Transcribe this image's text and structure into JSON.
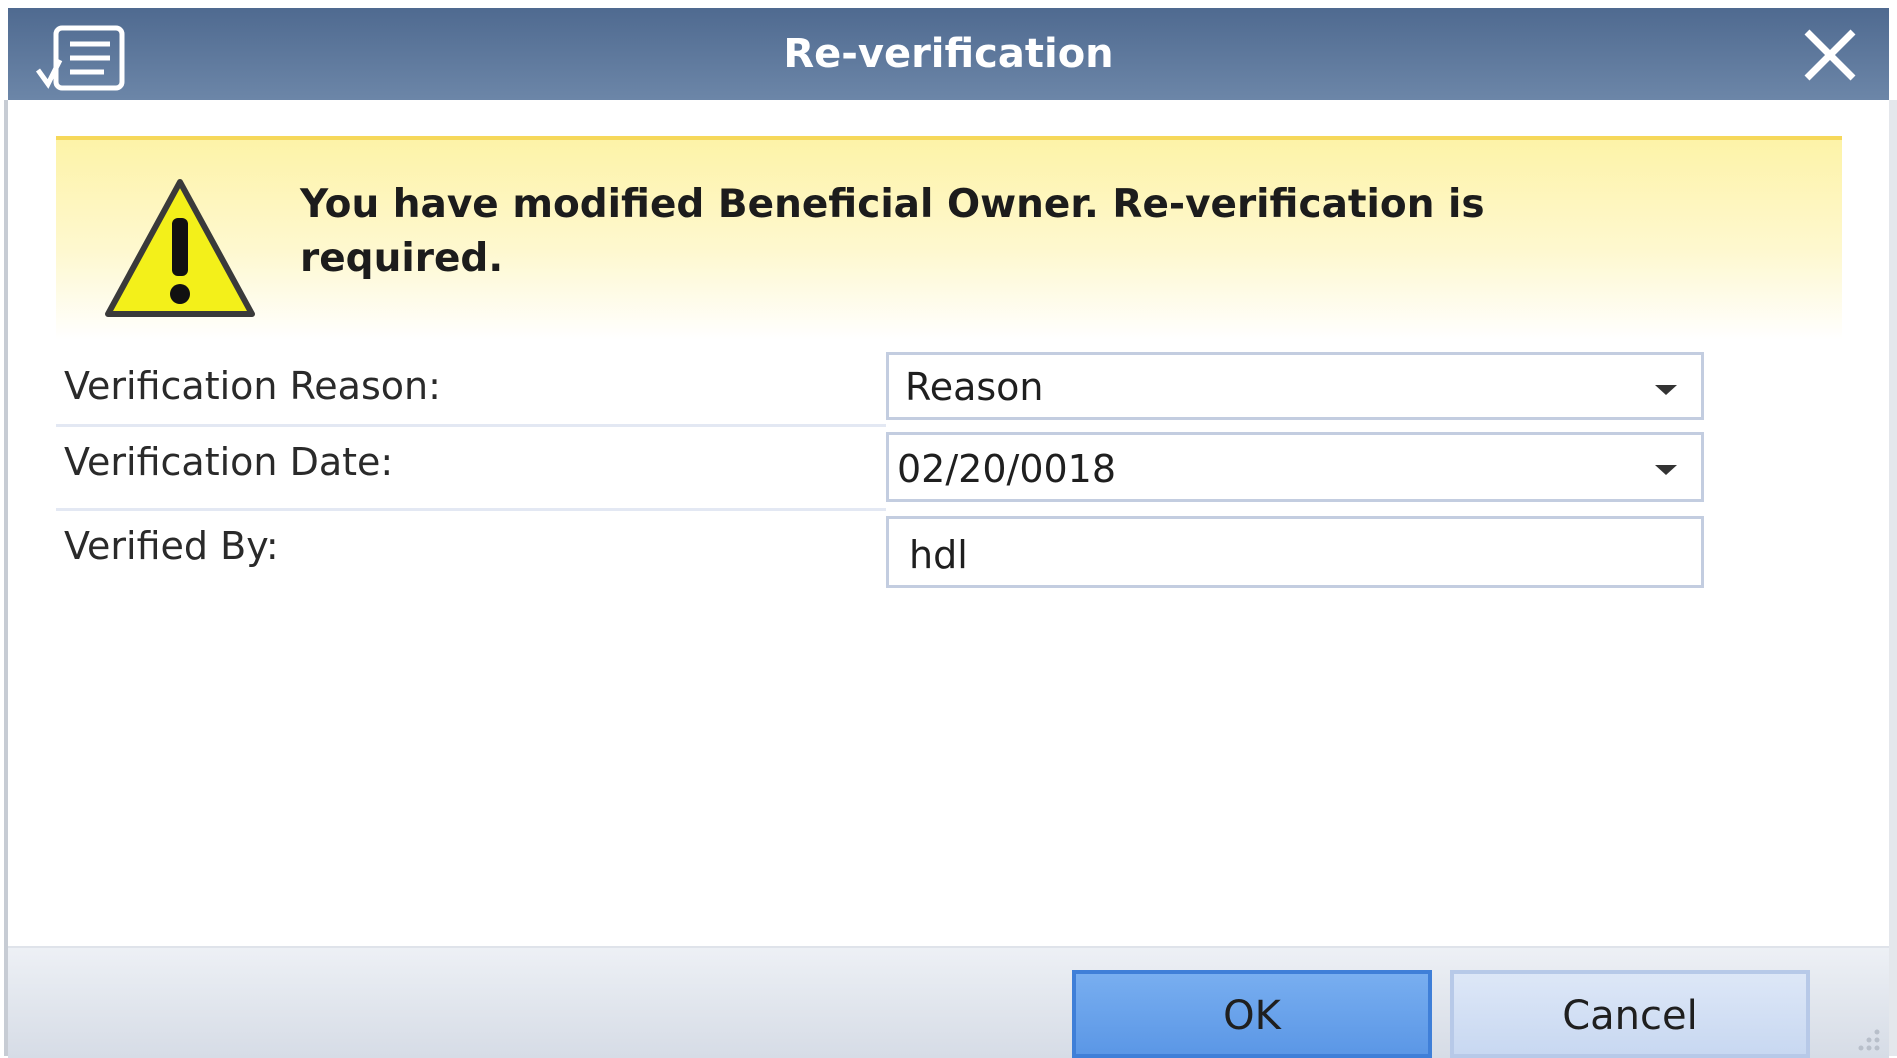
{
  "window": {
    "title": "Re-verification",
    "app_icon": "form-checklist-icon",
    "close_icon": "close-icon"
  },
  "banner": {
    "icon": "warning-icon",
    "message": "You have modified Beneficial Owner. Re-verification is required."
  },
  "form": {
    "reason_label": "Verification Reason:",
    "reason_value": "Reason",
    "date_label": "Verification Date:",
    "date_value": "02/20/0018",
    "verified_by_label": "Verified By:",
    "verified_by_value": "hdl"
  },
  "buttons": {
    "ok_label": "OK",
    "cancel_label": "Cancel"
  },
  "colors": {
    "titlebar": "#5a7599",
    "banner": "#fdf3a8",
    "ok_button": "#6aa3ec",
    "cancel_button": "#d2e0f4"
  }
}
